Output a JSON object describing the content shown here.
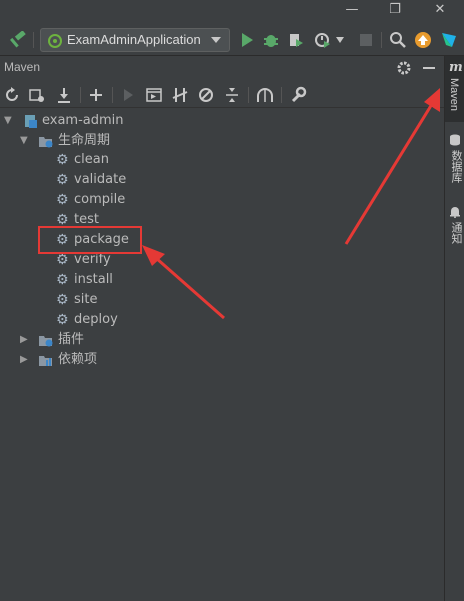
{
  "window": {
    "minimize_glyph": "—",
    "restore_glyph": "❐",
    "close_glyph": "✕"
  },
  "run_config": {
    "label": "ExamAdminApplication"
  },
  "panel": {
    "title": "Maven"
  },
  "tree": {
    "project": "exam-admin",
    "lifecycle": {
      "label": "生命周期",
      "phases": [
        "clean",
        "validate",
        "compile",
        "test",
        "package",
        "verify",
        "install",
        "site",
        "deploy"
      ]
    },
    "plugins": "插件",
    "dependencies": "依赖项"
  },
  "side_strip": {
    "maven_label": "Maven",
    "maven_glyph": "m",
    "database_label": "数据库",
    "notifications_label": "通知"
  },
  "annotations": {
    "highlighted_item": "package",
    "highlight_color": "#e53935"
  },
  "colors": {
    "panel_bg": "#3c3f41",
    "text": "#bbbbbb",
    "run_green": "#59a869",
    "update_orange": "#e89b2e"
  }
}
